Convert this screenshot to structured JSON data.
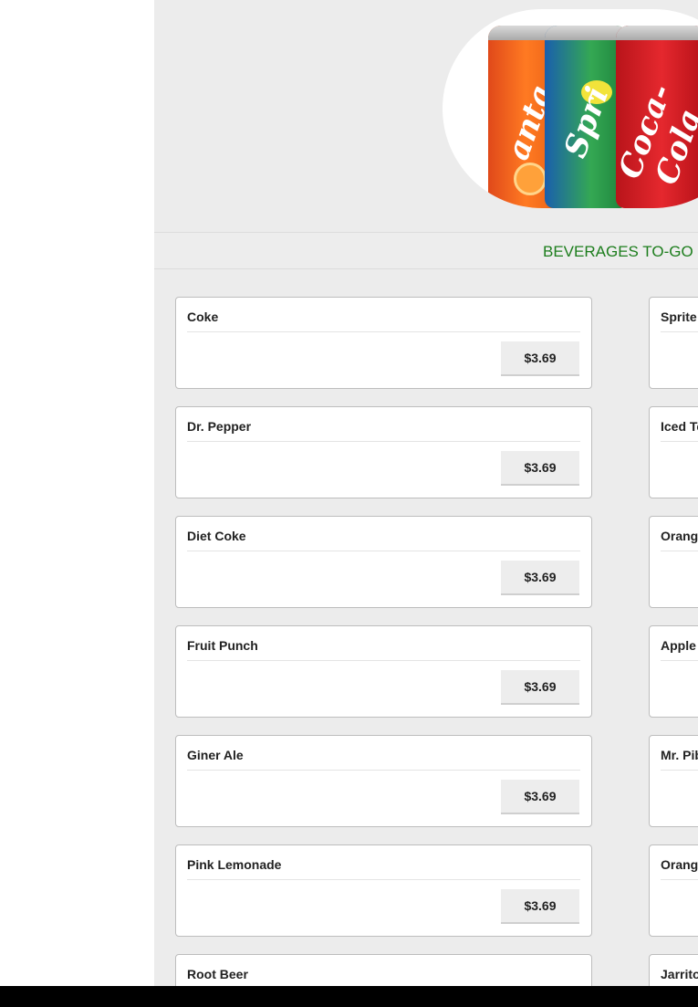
{
  "hero": {
    "cans": [
      {
        "brand": "Fanta",
        "text": "anta"
      },
      {
        "brand": "Sprite",
        "text": "Spri"
      },
      {
        "brand": "Coca-Cola",
        "text": "Coca-Cola"
      }
    ]
  },
  "section": {
    "title": "BEVERAGES TO-GO",
    "title_color": "#1c7d1c"
  },
  "menu": {
    "left_items": [
      {
        "name": "Coke",
        "price": "$3.69"
      },
      {
        "name": "Dr. Pepper",
        "price": "$3.69"
      },
      {
        "name": "Diet Coke",
        "price": "$3.69"
      },
      {
        "name": "Fruit Punch",
        "price": "$3.69"
      },
      {
        "name": "Giner Ale",
        "price": "$3.69"
      },
      {
        "name": "Pink Lemonade",
        "price": "$3.69"
      },
      {
        "name": "Root Beer",
        "price": ""
      }
    ],
    "right_items": [
      {
        "name": "Sprite"
      },
      {
        "name": "Iced Te"
      },
      {
        "name": "Orang"
      },
      {
        "name": "Apple"
      },
      {
        "name": "Mr. Pib"
      },
      {
        "name": "Orang"
      },
      {
        "name": "Jarritos"
      }
    ]
  }
}
